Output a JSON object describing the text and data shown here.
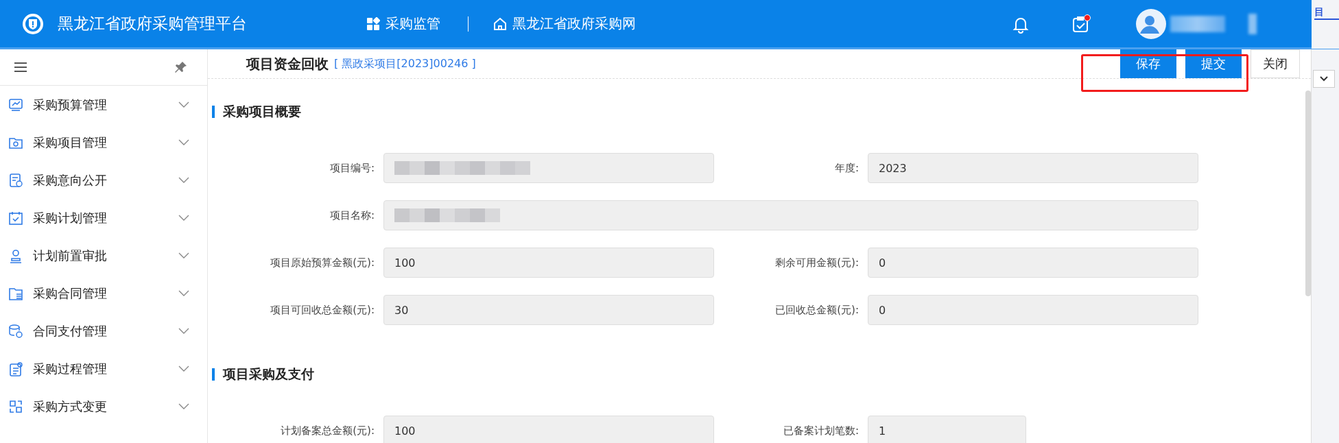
{
  "header": {
    "title": "黑龙江省政府采购管理平台",
    "nav": [
      {
        "label": "采购监管"
      },
      {
        "label": "黑龙江省政府采购网"
      }
    ],
    "notifications": {
      "unread": false
    },
    "tasks": {
      "unread": true
    }
  },
  "sidebar": {
    "items": [
      {
        "label": "采购预算管理",
        "expanded": false
      },
      {
        "label": "采购项目管理",
        "expanded": false
      },
      {
        "label": "采购意向公开",
        "expanded": false
      },
      {
        "label": "采购计划管理",
        "expanded": false
      },
      {
        "label": "计划前置审批",
        "expanded": false
      },
      {
        "label": "采购合同管理",
        "expanded": false
      },
      {
        "label": "合同支付管理",
        "expanded": false
      },
      {
        "label": "采购过程管理",
        "expanded": false
      },
      {
        "label": "采购方式变更",
        "expanded": false
      }
    ]
  },
  "page": {
    "title": "项目资金回收",
    "reference": "[ 黑政采项目[2023]00246 ]",
    "buttons": [
      {
        "label": "保存",
        "kind": "primary"
      },
      {
        "label": "提交",
        "kind": "primary"
      },
      {
        "label": "关闭",
        "kind": "plain"
      }
    ]
  },
  "sections": [
    {
      "title": "采购项目概要",
      "fields": [
        {
          "label": "项目编号:",
          "redacted": true,
          "wide": false
        },
        {
          "label": "年度:",
          "value": "2023",
          "redacted": false,
          "wide": false
        },
        {
          "label": "项目名称:",
          "redacted": true,
          "wide": true
        },
        {
          "label": "项目原始预算金额(元):",
          "value": "100",
          "redacted": false,
          "wide": false
        },
        {
          "label": "剩余可用金额(元):",
          "value": "0",
          "redacted": false,
          "wide": false
        },
        {
          "label": "项目可回收总金额(元):",
          "value": "30",
          "redacted": false,
          "wide": false
        },
        {
          "label": "已回收总金额(元):",
          "value": "0",
          "redacted": false,
          "wide": false
        }
      ]
    },
    {
      "title": "项目采购及支付",
      "fields": [
        {
          "label": "计划备案总金额(元):",
          "value": "100",
          "redacted": false,
          "wide": false
        },
        {
          "label": "已备案计划笔数:",
          "value": "1",
          "redacted": false,
          "wide": false,
          "short": true
        }
      ]
    }
  ],
  "side_panel": {
    "tab": "目"
  }
}
